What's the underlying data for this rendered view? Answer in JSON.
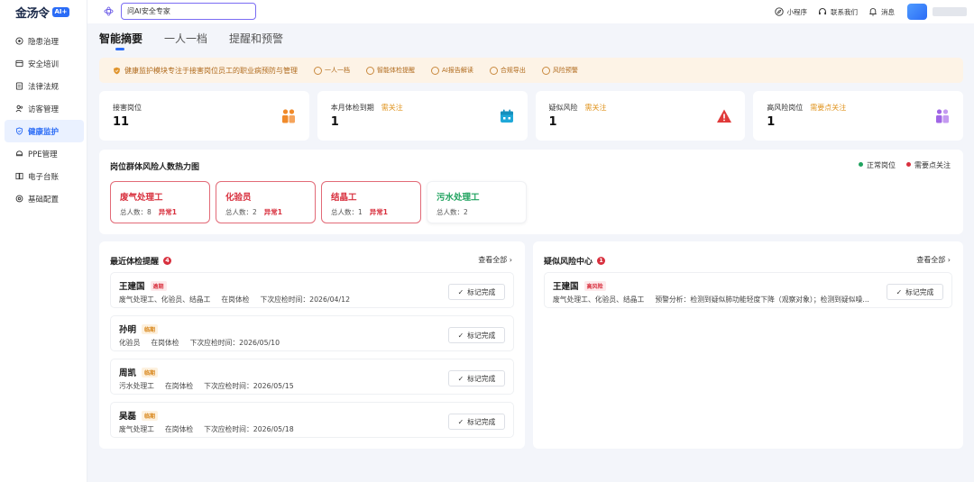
{
  "brand": {
    "name": "金汤令",
    "badge": "AI+"
  },
  "sidebar": {
    "items": [
      {
        "label": "隐患治理",
        "icon": "hazard-icon",
        "active": false
      },
      {
        "label": "安全培训",
        "icon": "training-icon",
        "active": false
      },
      {
        "label": "法律法规",
        "icon": "law-icon",
        "active": false
      },
      {
        "label": "访客管理",
        "icon": "visitor-icon",
        "active": false
      },
      {
        "label": "健康监护",
        "icon": "shield-icon",
        "active": true
      },
      {
        "label": "PPE管理",
        "icon": "ppe-icon",
        "active": false
      },
      {
        "label": "电子台账",
        "icon": "ledger-icon",
        "active": false
      },
      {
        "label": "基础配置",
        "icon": "config-icon",
        "active": false
      }
    ]
  },
  "topbar": {
    "search_value": "问AI安全专家",
    "mini_program": "小程序",
    "contact": "联系我们",
    "messages": "消息"
  },
  "tabs": [
    {
      "label": "智能摘要",
      "active": true
    },
    {
      "label": "一人一档",
      "active": false
    },
    {
      "label": "提醒和预警",
      "active": false
    }
  ],
  "banner": {
    "text": "健康监护模块专注于接害岗位员工的职业病预防与管理",
    "chips": [
      "一人一档",
      "智能体检提醒",
      "AI报告解读",
      "合规导出",
      "风险预警"
    ]
  },
  "stats": [
    {
      "label": "接害岗位",
      "tag": "",
      "value": "11",
      "icon": "people-icon",
      "color": "#f08a2a"
    },
    {
      "label": "本月体检到期",
      "tag": "需关注",
      "value": "1",
      "icon": "calendar-icon",
      "color": "#1fa8d8"
    },
    {
      "label": "疑似风险",
      "tag": "需关注",
      "value": "1",
      "icon": "warning-icon",
      "color": "#e03a3a"
    },
    {
      "label": "高风险岗位",
      "tag": "需要点关注",
      "value": "1",
      "icon": "group-icon",
      "color": "#a066e6"
    }
  ],
  "heatmap": {
    "title": "岗位群体风险人数热力图",
    "legend_normal": "正常岗位",
    "legend_attention": "需要点关注",
    "color_normal": "#20a35f",
    "color_attention": "#d8303e",
    "cards": [
      {
        "name": "废气处理工",
        "total_label": "总人数：",
        "total": "8",
        "abnormal": "异常1",
        "risk": true
      },
      {
        "name": "化验员",
        "total_label": "总人数：",
        "total": "2",
        "abnormal": "异常1",
        "risk": true
      },
      {
        "name": "结晶工",
        "total_label": "总人数：",
        "total": "1",
        "abnormal": "异常1",
        "risk": true
      },
      {
        "name": "污水处理工",
        "total_label": "总人数：",
        "total": "2",
        "abnormal": "",
        "risk": false
      }
    ]
  },
  "checkup": {
    "title": "最近体检提醒",
    "count": "4",
    "view_all": "查看全部",
    "mark_label": "标记完成",
    "rows": [
      {
        "name": "王建国",
        "badge": "逾期",
        "badge_type": "overdue",
        "posts": "废气处理工、化验员、结晶工",
        "type": "在岗体检",
        "next": "下次应检时间：2026/04/12"
      },
      {
        "name": "孙明",
        "badge": "临期",
        "badge_type": "soon",
        "posts": "化验员",
        "type": "在岗体检",
        "next": "下次应检时间：2026/05/10"
      },
      {
        "name": "周凯",
        "badge": "临期",
        "badge_type": "soon",
        "posts": "污水处理工",
        "type": "在岗体检",
        "next": "下次应检时间：2026/05/15"
      },
      {
        "name": "吴磊",
        "badge": "临期",
        "badge_type": "soon",
        "posts": "废气处理工",
        "type": "在岗体检",
        "next": "下次应检时间：2026/05/18"
      }
    ]
  },
  "risk_center": {
    "title": "疑似风险中心",
    "count": "1",
    "view_all": "查看全部",
    "mark_label": "标记完成",
    "rows": [
      {
        "name": "王建国",
        "badge": "高风险",
        "posts": "废气处理工、化验员、结晶工",
        "analysis": "预警分析：检测到疑似肺功能轻度下降（观察对象）；检测到疑似噪..."
      }
    ]
  }
}
